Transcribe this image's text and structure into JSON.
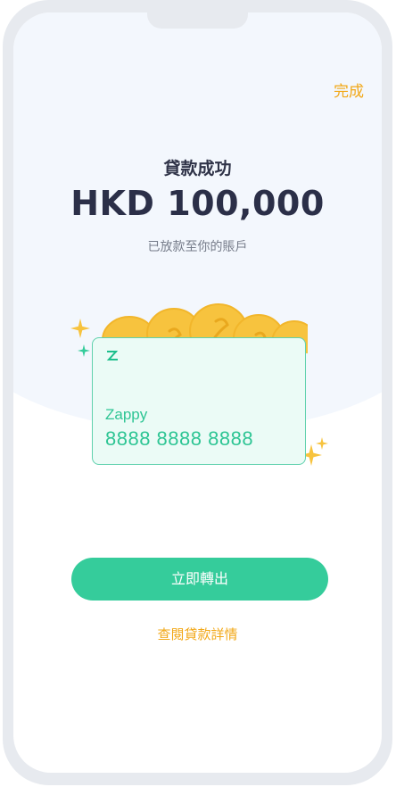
{
  "header": {
    "done_label": "完成"
  },
  "result": {
    "title": "貸款成功",
    "amount": "HKD 100,000",
    "subtitle": "已放款至你的賬戶"
  },
  "card": {
    "brand_icon": "zappy-logo-icon",
    "name": "Zappy",
    "number": "8888 8888 8888"
  },
  "actions": {
    "primary_label": "立即轉出",
    "secondary_label": "查閱貸款詳情"
  },
  "colors": {
    "accent": "#f2a818",
    "primary": "#35cc9b",
    "card_text": "#2ec594",
    "coin": "#f7c33e"
  }
}
